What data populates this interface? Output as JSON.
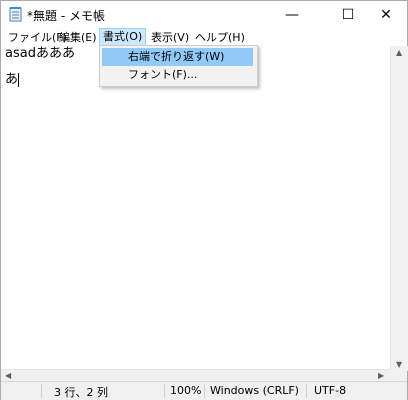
{
  "window": {
    "title": "*無題 - メモ帳",
    "icon": "notepad-icon",
    "controls": {
      "minimize": "—",
      "maximize": "☐",
      "close": "✕"
    }
  },
  "menubar": {
    "items": [
      {
        "label": "ファイル(F)",
        "active": false
      },
      {
        "label": "編集(E)",
        "active": false
      },
      {
        "label": "書式(O)",
        "active": true
      },
      {
        "label": "表示(V)",
        "active": false
      },
      {
        "label": "ヘルプ(H)",
        "active": false
      }
    ]
  },
  "editor": {
    "lines": [
      "asadあああ",
      "",
      "あ"
    ]
  },
  "format_menu": {
    "items": [
      {
        "label": "右端で折り返す(W)",
        "highlighted": true
      },
      {
        "label": "フォント(F)...",
        "highlighted": false
      }
    ]
  },
  "statusbar": {
    "position": "3 行、2 列",
    "zoom": "100%",
    "line_ending": "Windows (CRLF)",
    "encoding": "UTF-8"
  },
  "colors": {
    "menu_highlight": "#91c9f7",
    "active_menu_bg": "#cce8ff",
    "statusbar_bg": "#f0f0f0"
  }
}
